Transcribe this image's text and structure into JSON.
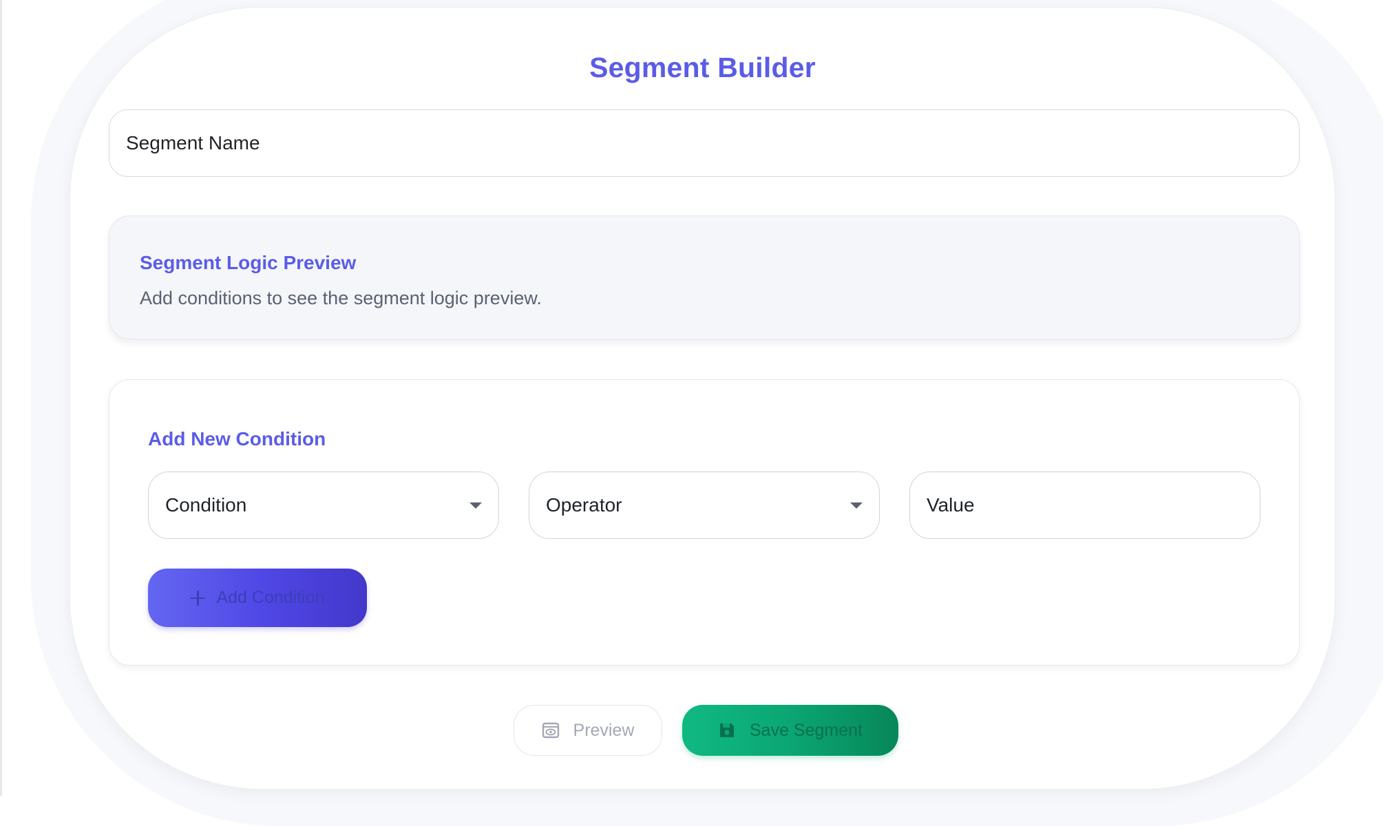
{
  "header": {
    "title": "Segment Builder"
  },
  "segment_name": {
    "placeholder": "Segment Name",
    "value": ""
  },
  "logic_preview": {
    "title": "Segment Logic Preview",
    "empty_text": "Add conditions to see the segment logic preview."
  },
  "new_condition": {
    "title": "Add New Condition",
    "condition_select": {
      "selected": "Condition"
    },
    "operator_select": {
      "selected": "Operator"
    },
    "value_input": {
      "placeholder": "Value",
      "value": ""
    },
    "add_button_label": "Add Condition"
  },
  "footer": {
    "preview_label": "Preview",
    "save_label": "Save Segment"
  },
  "colors": {
    "accent": "#5b5ce6",
    "primary_gradient_start": "#6366f1",
    "primary_gradient_end": "#4338ca",
    "success_gradient_start": "#10b981",
    "success_gradient_end": "#078759"
  },
  "icons": {
    "add": "plus-icon",
    "preview": "eye-icon",
    "save": "floppy-disk-icon",
    "select": "chevron-down-icon"
  }
}
